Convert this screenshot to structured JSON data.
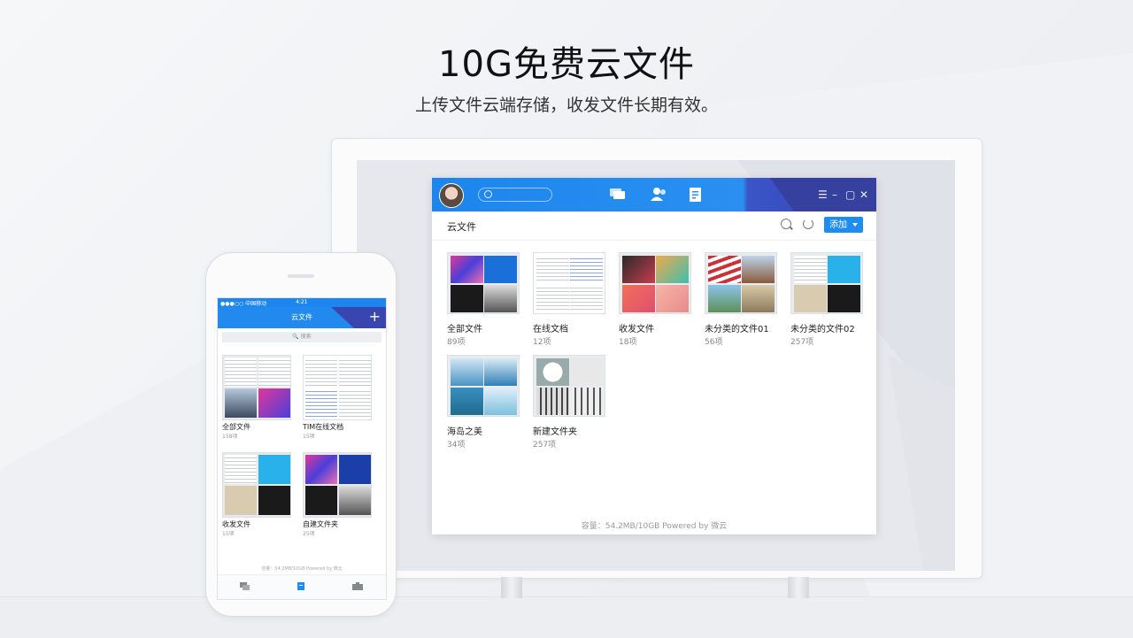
{
  "hero": {
    "title": "10G免费云文件",
    "subtitle": "上传文件云端存储，收发文件长期有效。"
  },
  "desktop": {
    "window_controls": [
      "☰",
      "–",
      "▢",
      "✕"
    ],
    "icons": {
      "search": "search-icon",
      "chat": "chat-icon",
      "contacts": "contacts-icon",
      "files": "files-icon",
      "refresh": "refresh-icon"
    },
    "toolbar": {
      "title": "云文件",
      "add_label": "添加"
    },
    "folders": [
      {
        "name": "全部文件",
        "count": "89项"
      },
      {
        "name": "在线文档",
        "count": "12项"
      },
      {
        "name": "收发文件",
        "count": "18项"
      },
      {
        "name": "未分类的文件01",
        "count": "56项"
      },
      {
        "name": "未分类的文件02",
        "count": "257项"
      },
      {
        "name": "海岛之美",
        "count": "34项"
      },
      {
        "name": "新建文件夹",
        "count": "257项"
      }
    ],
    "footer": "容量：54.2MB/10GB    Powered by 微云"
  },
  "phone": {
    "status": {
      "carrier": "●●●○○ 中国移动",
      "time": "4:21"
    },
    "title": "云文件",
    "plus": "+",
    "search_placeholder": "🔍 搜索",
    "folders": [
      {
        "name": "全部文件",
        "count": "158项"
      },
      {
        "name": "TIM在线文档",
        "count": "15项"
      },
      {
        "name": "收发文件",
        "count": "15项"
      },
      {
        "name": "自建文件夹",
        "count": "25项"
      }
    ],
    "footer": "容量：54.2MB/10GB  Powered by 微云"
  },
  "colors": {
    "accent": "#1f8cf0",
    "header_dark": "#35409f"
  }
}
